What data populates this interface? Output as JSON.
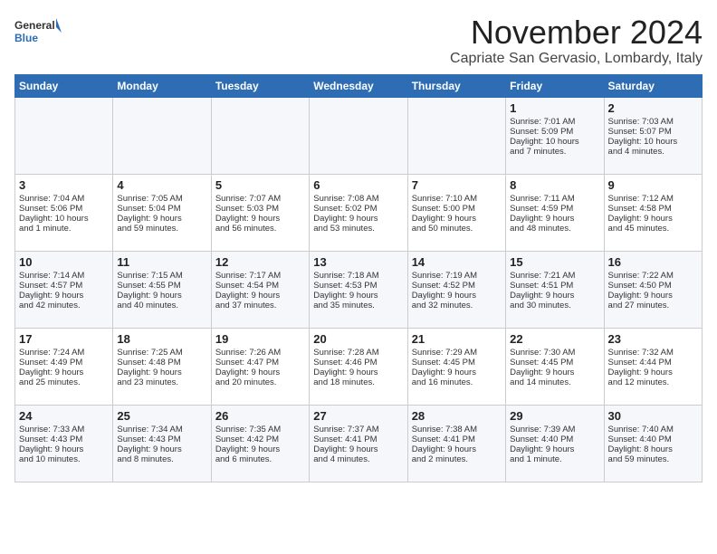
{
  "logo": {
    "line1": "General",
    "line2": "Blue"
  },
  "title": "November 2024",
  "location": "Capriate San Gervasio, Lombardy, Italy",
  "weekdays": [
    "Sunday",
    "Monday",
    "Tuesday",
    "Wednesday",
    "Thursday",
    "Friday",
    "Saturday"
  ],
  "weeks": [
    [
      {
        "day": "",
        "text": ""
      },
      {
        "day": "",
        "text": ""
      },
      {
        "day": "",
        "text": ""
      },
      {
        "day": "",
        "text": ""
      },
      {
        "day": "",
        "text": ""
      },
      {
        "day": "1",
        "text": "Sunrise: 7:01 AM\nSunset: 5:09 PM\nDaylight: 10 hours\nand 7 minutes."
      },
      {
        "day": "2",
        "text": "Sunrise: 7:03 AM\nSunset: 5:07 PM\nDaylight: 10 hours\nand 4 minutes."
      }
    ],
    [
      {
        "day": "3",
        "text": "Sunrise: 7:04 AM\nSunset: 5:06 PM\nDaylight: 10 hours\nand 1 minute."
      },
      {
        "day": "4",
        "text": "Sunrise: 7:05 AM\nSunset: 5:04 PM\nDaylight: 9 hours\nand 59 minutes."
      },
      {
        "day": "5",
        "text": "Sunrise: 7:07 AM\nSunset: 5:03 PM\nDaylight: 9 hours\nand 56 minutes."
      },
      {
        "day": "6",
        "text": "Sunrise: 7:08 AM\nSunset: 5:02 PM\nDaylight: 9 hours\nand 53 minutes."
      },
      {
        "day": "7",
        "text": "Sunrise: 7:10 AM\nSunset: 5:00 PM\nDaylight: 9 hours\nand 50 minutes."
      },
      {
        "day": "8",
        "text": "Sunrise: 7:11 AM\nSunset: 4:59 PM\nDaylight: 9 hours\nand 48 minutes."
      },
      {
        "day": "9",
        "text": "Sunrise: 7:12 AM\nSunset: 4:58 PM\nDaylight: 9 hours\nand 45 minutes."
      }
    ],
    [
      {
        "day": "10",
        "text": "Sunrise: 7:14 AM\nSunset: 4:57 PM\nDaylight: 9 hours\nand 42 minutes."
      },
      {
        "day": "11",
        "text": "Sunrise: 7:15 AM\nSunset: 4:55 PM\nDaylight: 9 hours\nand 40 minutes."
      },
      {
        "day": "12",
        "text": "Sunrise: 7:17 AM\nSunset: 4:54 PM\nDaylight: 9 hours\nand 37 minutes."
      },
      {
        "day": "13",
        "text": "Sunrise: 7:18 AM\nSunset: 4:53 PM\nDaylight: 9 hours\nand 35 minutes."
      },
      {
        "day": "14",
        "text": "Sunrise: 7:19 AM\nSunset: 4:52 PM\nDaylight: 9 hours\nand 32 minutes."
      },
      {
        "day": "15",
        "text": "Sunrise: 7:21 AM\nSunset: 4:51 PM\nDaylight: 9 hours\nand 30 minutes."
      },
      {
        "day": "16",
        "text": "Sunrise: 7:22 AM\nSunset: 4:50 PM\nDaylight: 9 hours\nand 27 minutes."
      }
    ],
    [
      {
        "day": "17",
        "text": "Sunrise: 7:24 AM\nSunset: 4:49 PM\nDaylight: 9 hours\nand 25 minutes."
      },
      {
        "day": "18",
        "text": "Sunrise: 7:25 AM\nSunset: 4:48 PM\nDaylight: 9 hours\nand 23 minutes."
      },
      {
        "day": "19",
        "text": "Sunrise: 7:26 AM\nSunset: 4:47 PM\nDaylight: 9 hours\nand 20 minutes."
      },
      {
        "day": "20",
        "text": "Sunrise: 7:28 AM\nSunset: 4:46 PM\nDaylight: 9 hours\nand 18 minutes."
      },
      {
        "day": "21",
        "text": "Sunrise: 7:29 AM\nSunset: 4:45 PM\nDaylight: 9 hours\nand 16 minutes."
      },
      {
        "day": "22",
        "text": "Sunrise: 7:30 AM\nSunset: 4:45 PM\nDaylight: 9 hours\nand 14 minutes."
      },
      {
        "day": "23",
        "text": "Sunrise: 7:32 AM\nSunset: 4:44 PM\nDaylight: 9 hours\nand 12 minutes."
      }
    ],
    [
      {
        "day": "24",
        "text": "Sunrise: 7:33 AM\nSunset: 4:43 PM\nDaylight: 9 hours\nand 10 minutes."
      },
      {
        "day": "25",
        "text": "Sunrise: 7:34 AM\nSunset: 4:43 PM\nDaylight: 9 hours\nand 8 minutes."
      },
      {
        "day": "26",
        "text": "Sunrise: 7:35 AM\nSunset: 4:42 PM\nDaylight: 9 hours\nand 6 minutes."
      },
      {
        "day": "27",
        "text": "Sunrise: 7:37 AM\nSunset: 4:41 PM\nDaylight: 9 hours\nand 4 minutes."
      },
      {
        "day": "28",
        "text": "Sunrise: 7:38 AM\nSunset: 4:41 PM\nDaylight: 9 hours\nand 2 minutes."
      },
      {
        "day": "29",
        "text": "Sunrise: 7:39 AM\nSunset: 4:40 PM\nDaylight: 9 hours\nand 1 minute."
      },
      {
        "day": "30",
        "text": "Sunrise: 7:40 AM\nSunset: 4:40 PM\nDaylight: 8 hours\nand 59 minutes."
      }
    ]
  ]
}
